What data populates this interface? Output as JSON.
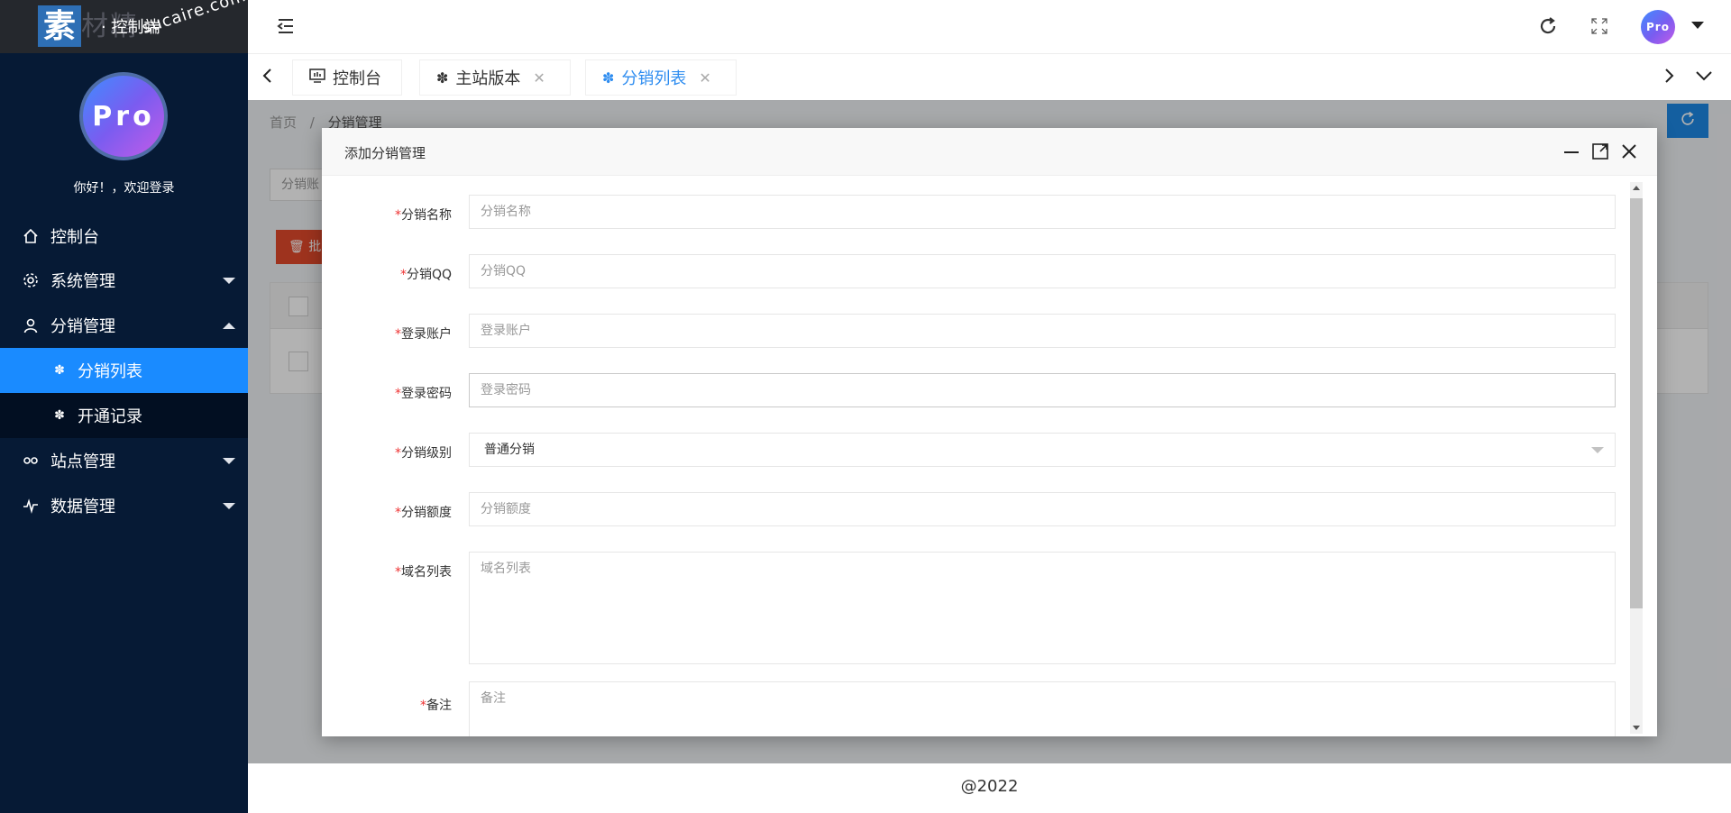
{
  "sidebar": {
    "logo_char": "素",
    "logo_sub": "材精",
    "logo_text": "· 控制端",
    "watermark": "sucaire.com",
    "avatar_text": "Pro",
    "welcome": "你好！，欢迎登录",
    "items": [
      {
        "label": "控制台",
        "icon": "home-icon"
      },
      {
        "label": "系统管理",
        "icon": "gear-icon"
      },
      {
        "label": "分销管理",
        "icon": "user-icon"
      },
      {
        "label": "分销列表",
        "icon": "palm-icon"
      },
      {
        "label": "开通记录",
        "icon": "palm-icon"
      },
      {
        "label": "站点管理",
        "icon": "link-icon"
      },
      {
        "label": "数据管理",
        "icon": "pulse-icon"
      }
    ]
  },
  "topbar": {
    "avatar_text": "Pro"
  },
  "tabs": [
    {
      "label": "控制台"
    },
    {
      "label": "主站版本"
    },
    {
      "label": "分销列表"
    }
  ],
  "background_page": {
    "breadcrumb_home": "首页",
    "breadcrumb_sep": "/",
    "breadcrumb_current": "分销管理",
    "search_placeholder_fragment": "分销账",
    "batch_button_fragment": "批"
  },
  "modal": {
    "title": "添加分销管理",
    "fields": [
      {
        "label": "分销名称",
        "placeholder": "分销名称"
      },
      {
        "label": "分销QQ",
        "placeholder": "分销QQ"
      },
      {
        "label": "登录账户",
        "placeholder": "登录账户"
      },
      {
        "label": "登录密码",
        "placeholder": "登录密码"
      },
      {
        "label": "分销级别",
        "value": "普通分销"
      },
      {
        "label": "分销额度",
        "placeholder": "分销额度"
      },
      {
        "label": "域名列表",
        "placeholder": "域名列表"
      },
      {
        "label": "备注",
        "placeholder": "备注"
      }
    ],
    "required_mark": "*"
  },
  "footer": {
    "text": "@2022"
  },
  "colors": {
    "sidebar_bg": "#061a35",
    "active_menu": "#1a8bff",
    "active_tab": "#2d8cf0",
    "required": "#e33333",
    "batch_delete": "#e2492b"
  }
}
